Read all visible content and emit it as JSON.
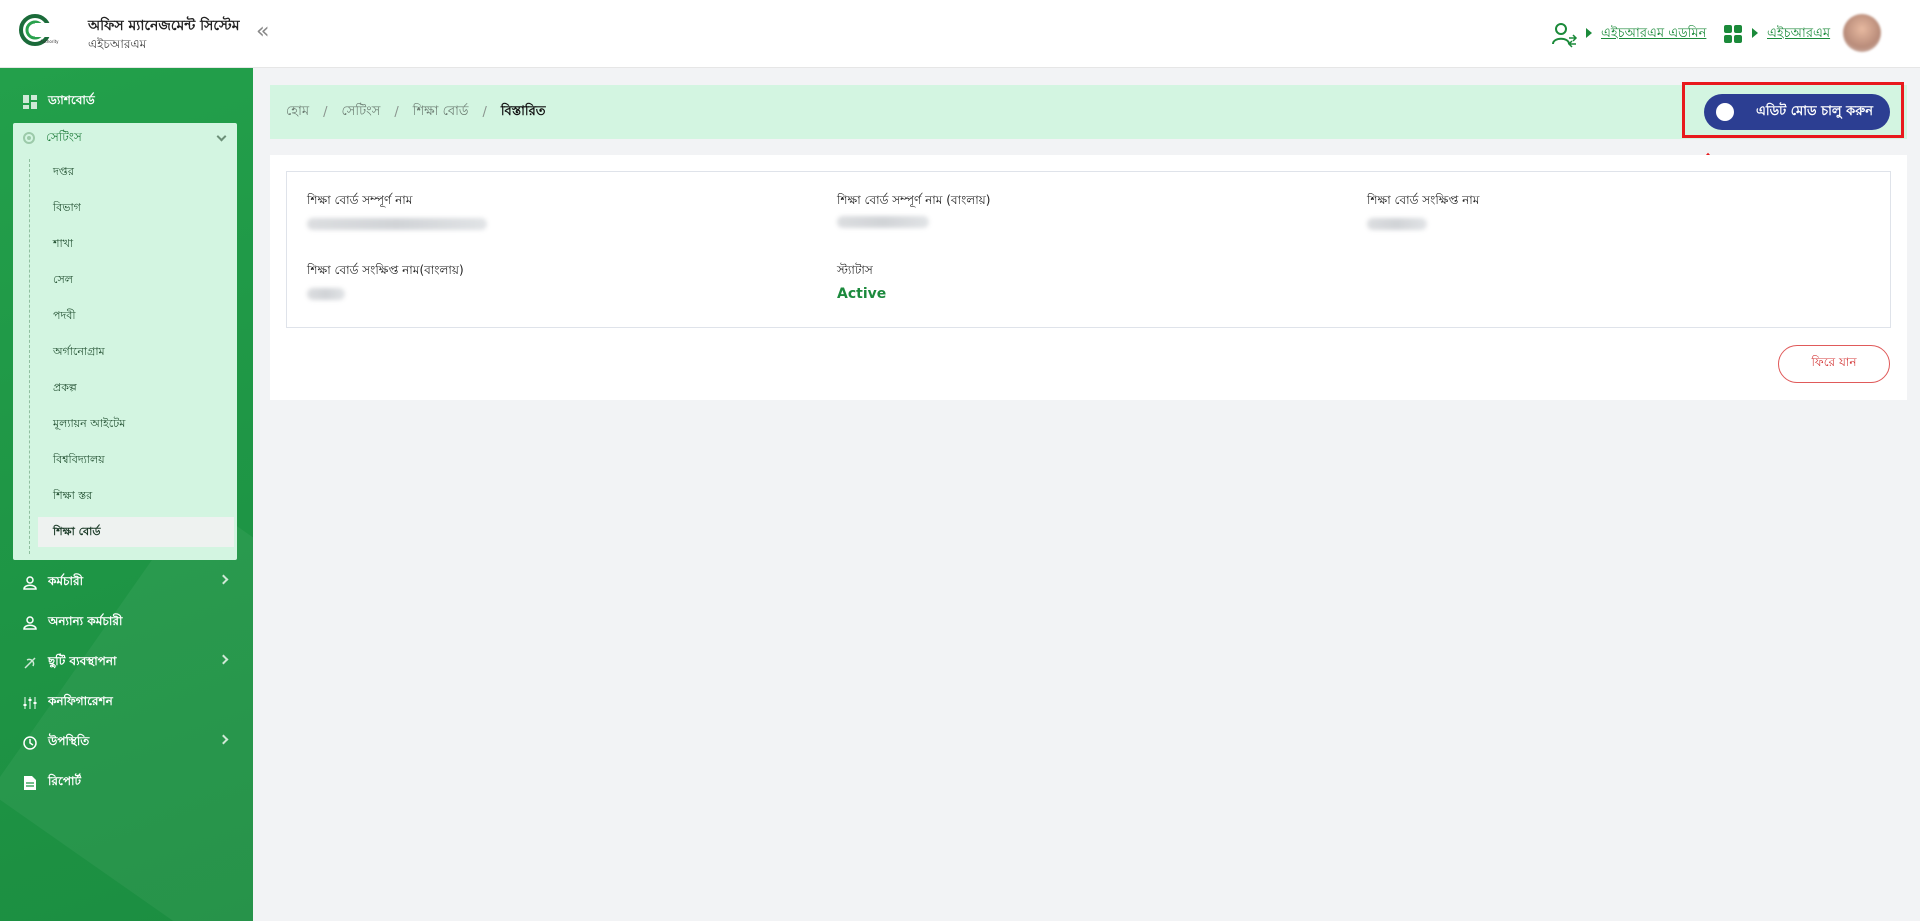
{
  "app": {
    "title": "অফিস ম্যানেজমেন্ট সিস্টেম",
    "subtitle": "এইচআরএম",
    "logo_icon": "authority-logo",
    "collapse_icon": "«"
  },
  "header": {
    "role_link": "এইচআরএম এডমিন",
    "module_link": "এইচআরএম",
    "accent": "#1b8a3a"
  },
  "sidebar": {
    "items": [
      {
        "label": "ড্যাশবোর্ড",
        "icon": "dashboard-icon"
      },
      {
        "label": "কর্মচারী",
        "icon": "employee-icon",
        "has_children": true
      },
      {
        "label": "অন্যান্য কর্মচারী",
        "icon": "other-employee-icon"
      },
      {
        "label": "ছুটি ব্যবস্থাপনা",
        "icon": "leave-icon",
        "has_children": true
      },
      {
        "label": "কনফিগারেশন",
        "icon": "configuration-icon"
      },
      {
        "label": "উপস্থিতি",
        "icon": "attendance-icon",
        "has_children": true
      },
      {
        "label": "রিপোর্ট",
        "icon": "report-icon"
      }
    ],
    "settings": {
      "label": "সেটিংস",
      "children": [
        "দপ্তর",
        "বিভাগ",
        "শাখা",
        "সেল",
        "পদবী",
        "অর্গানোগ্রাম",
        "প্রকল্প",
        "মূল্যায়ন আইটেম",
        "বিশ্ববিদ্যালয়",
        "শিক্ষা স্তর",
        "শিক্ষা বোর্ড"
      ],
      "active_child": "শিক্ষা বোর্ড"
    }
  },
  "breadcrumb": [
    "হোম",
    "সেটিংস",
    "শিক্ষা বোর্ড",
    "বিস্তারিত"
  ],
  "edit_mode_button": "এডিট মোড চালু করুন",
  "details": {
    "full_name_label": "শিক্ষা বোর্ড সম্পূর্ণ নাম",
    "full_name_bn_label": "শিক্ষা বোর্ড সম্পূর্ণ নাম (বাংলায়)",
    "short_name_label": "শিক্ষা বোর্ড সংক্ষিপ্ত নাম",
    "short_name_bn_label": "শিক্ষা বোর্ড সংক্ষিপ্ত নাম(বাংলায়)",
    "status_label": "স্ট্যাটাস",
    "status_value": "Active",
    "status_color": "#1c8a3d"
  },
  "back_button": "ফিরে যান",
  "colors": {
    "sidebar": "#1f9746",
    "breadcrumb_bg": "#d3f5e1",
    "edit_button": "#2c3e92",
    "highlight": "#e8191c"
  }
}
